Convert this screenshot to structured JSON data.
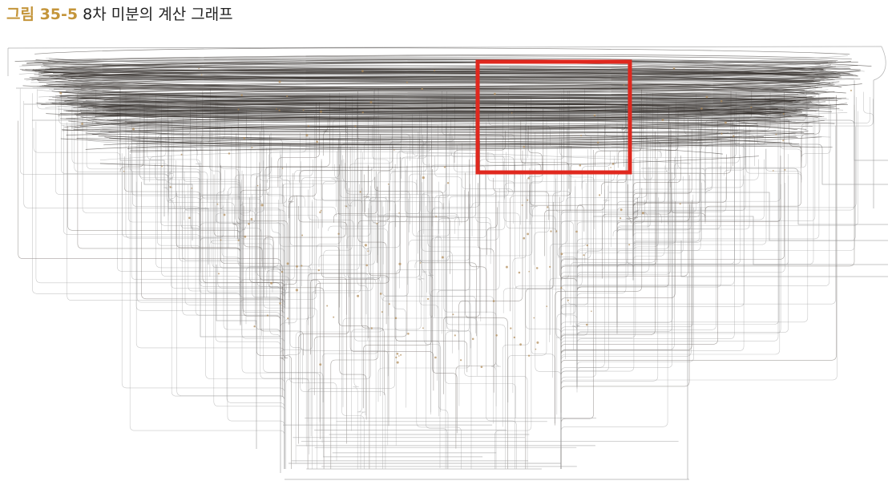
{
  "caption": {
    "label": "그림 35-5",
    "title": "8차 미분의 계산 그래프"
  },
  "colors": {
    "caption_label": "#c4953a",
    "caption_title": "#222222",
    "edge_dark": "#2a2520",
    "edge_light": "#9a9a9a",
    "node": "#b08a55",
    "highlight_box": "#e0281e"
  },
  "highlight": {
    "description_color": "red"
  }
}
